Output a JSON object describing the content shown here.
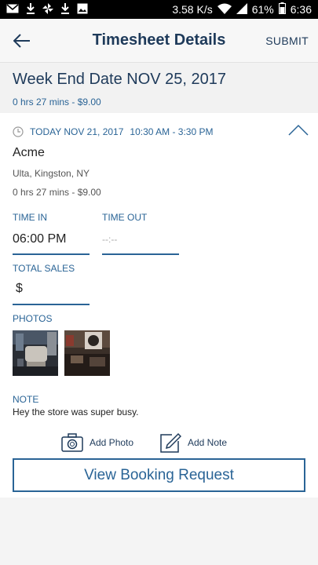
{
  "status_bar": {
    "speed": "3.58 K/s",
    "battery": "61%",
    "time": "6:36"
  },
  "app_bar": {
    "title": "Timesheet Details",
    "submit_label": "SUBMIT"
  },
  "week": {
    "title": "Week End Date NOV 25, 2017",
    "summary": "0 hrs 27 mins - $9.00"
  },
  "entry": {
    "date": "TODAY NOV 21, 2017",
    "time_range": "10:30 AM - 3:30 PM",
    "client": "Acme",
    "location": "Ulta, Kingston, NY",
    "summary": "0 hrs 27 mins - $9.00",
    "time_in_label": "TIME IN",
    "time_in_value": "06:00 PM",
    "time_out_label": "TIME OUT",
    "time_out_value": "--:--",
    "total_sales_label": "TOTAL SALES",
    "total_sales_value": "$",
    "photos_label": "PHOTOS",
    "note_label": "NOTE",
    "note_text": "Hey the store was super busy."
  },
  "actions": {
    "add_photo": "Add Photo",
    "add_note": "Add Note",
    "view_booking": "View Booking Request"
  },
  "colors": {
    "primary": "#2a6496",
    "title": "#1e3a5a"
  }
}
